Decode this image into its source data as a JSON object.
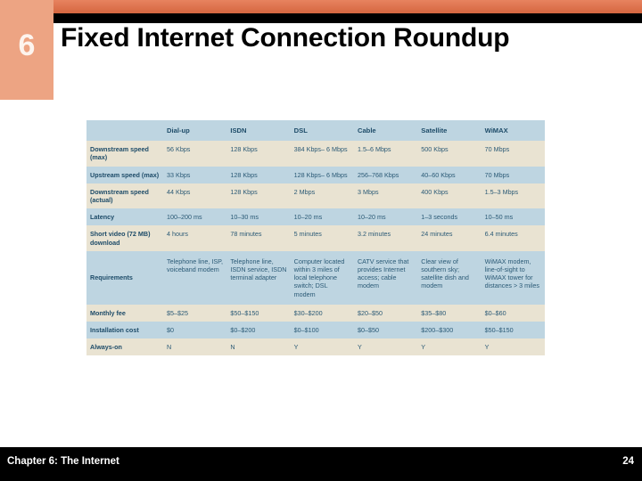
{
  "slide": {
    "chapter_number": "6",
    "title": "Fixed Internet Connection Roundup",
    "accent_color": "#eda483",
    "banner_color": "#e2673c",
    "table_header_color": "#bed5e1",
    "table_row_beige": "#e9e3d2",
    "table_row_blue": "#bed5e1",
    "table_text_color": "#2b5a76"
  },
  "table": {
    "columns": [
      "",
      "Dial-up",
      "ISDN",
      "DSL",
      "Cable",
      "Satellite",
      "WiMAX"
    ],
    "rows": [
      {
        "label": "Downstream speed (max)",
        "shade": "beige",
        "tall": false,
        "cells": [
          "56 Kbps",
          "128 Kbps",
          "384 Kbps– 6 Mbps",
          "1.5–6 Mbps",
          "500 Kbps",
          "70 Mbps"
        ]
      },
      {
        "label": "Upstream speed (max)",
        "shade": "blue",
        "tall": false,
        "cells": [
          "33 Kbps",
          "128 Kbps",
          "128 Kbps– 6 Mbps",
          "256–768 Kbps",
          "40–60 Kbps",
          "70 Mbps"
        ]
      },
      {
        "label": "Downstream speed (actual)",
        "shade": "beige",
        "tall": false,
        "cells": [
          "44 Kbps",
          "128 Kbps",
          "2 Mbps",
          "3 Mbps",
          "400 Kbps",
          "1.5–3 Mbps"
        ]
      },
      {
        "label": "Latency",
        "shade": "blue",
        "tall": false,
        "cells": [
          "100–200 ms",
          "10–30 ms",
          "10–20 ms",
          "10–20 ms",
          "1–3 seconds",
          "10–50 ms"
        ]
      },
      {
        "label": "Short video (72 MB) download",
        "shade": "beige",
        "tall": false,
        "cells": [
          "4 hours",
          "78 minutes",
          "5 minutes",
          "3.2 minutes",
          "24 minutes",
          "6.4 minutes"
        ]
      },
      {
        "label": "Requirements",
        "shade": "blue",
        "tall": true,
        "cells": [
          "Telephone line, ISP, voiceband modem",
          "Telephone line, ISDN service, ISDN terminal adapter",
          "Computer located within 3 miles of local telephone switch; DSL modem",
          "CATV service that provides Internet access; cable modem",
          "Clear view of southern sky; satellite dish and modem",
          "WiMAX modem, line-of-sight to WiMAX tower for distances > 3 miles"
        ]
      },
      {
        "label": "Monthly fee",
        "shade": "beige",
        "tall": false,
        "cells": [
          "$5–$25",
          "$50–$150",
          "$30–$200",
          "$20–$50",
          "$35–$80",
          "$0–$60"
        ]
      },
      {
        "label": "Installation cost",
        "shade": "blue",
        "tall": false,
        "cells": [
          "$0",
          "$0–$200",
          "$0–$100",
          "$0–$50",
          "$200–$300",
          "$50–$150"
        ]
      },
      {
        "label": "Always-on",
        "shade": "beige",
        "tall": false,
        "cells": [
          "N",
          "N",
          "Y",
          "Y",
          "Y",
          "Y"
        ]
      }
    ]
  },
  "footer": {
    "chapter_label": "Chapter 6: The Internet",
    "page_number": "24"
  }
}
